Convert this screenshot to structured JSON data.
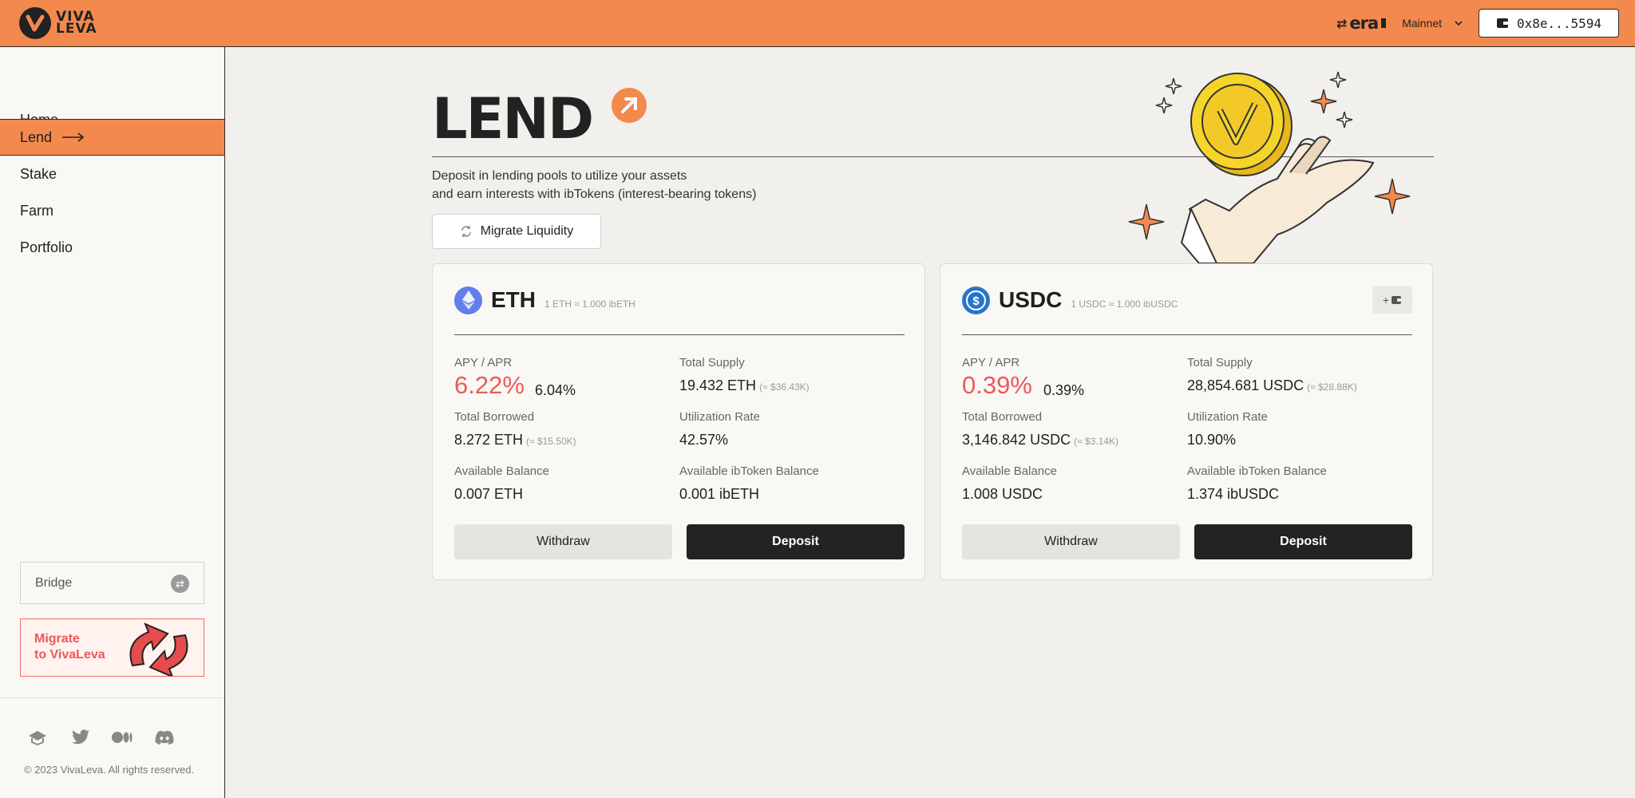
{
  "header": {
    "logo_text_line1": "VIVA",
    "logo_text_line2": "LEVA",
    "chain_name": "era",
    "network_label": "Mainnet",
    "wallet_address": "0x8e...5594"
  },
  "sidebar": {
    "items": [
      {
        "label": "Home"
      },
      {
        "label": "Lend"
      },
      {
        "label": "Stake"
      },
      {
        "label": "Farm"
      },
      {
        "label": "Portfolio"
      }
    ],
    "bridge_label": "Bridge",
    "migrate_line1": "Migrate",
    "migrate_line2": "to VivaLeva",
    "copyright": "© 2023 VivaLeva. All rights reserved."
  },
  "hero": {
    "title": "LEND",
    "desc_line1": "Deposit in lending pools to utilize your assets",
    "desc_line2": "and earn interests with ibTokens (interest-bearing tokens)",
    "migrate_liquidity": "Migrate Liquidity"
  },
  "pools": [
    {
      "token": "ETH",
      "rate": "1 ETH ≈ 1.000 ibETH",
      "apy_label": "APY / APR",
      "apy": "6.22%",
      "apr": "6.04%",
      "total_supply_label": "Total Supply",
      "total_supply": "19.432 ETH",
      "total_supply_usd": "(≈ $36.43K)",
      "total_borrowed_label": "Total Borrowed",
      "total_borrowed": "8.272 ETH",
      "total_borrowed_usd": "(≈ $15.50K)",
      "utilization_label": "Utilization Rate",
      "utilization": "42.57%",
      "available_label": "Available Balance",
      "available": "0.007 ETH",
      "ib_balance_label": "Available ibToken Balance",
      "ib_balance": "0.001 ibETH",
      "withdraw": "Withdraw",
      "deposit": "Deposit",
      "icon": "eth-icon",
      "icon_color": "#627eea"
    },
    {
      "token": "USDC",
      "rate": "1 USDC ≈ 1.000 ibUSDC",
      "apy_label": "APY / APR",
      "apy": "0.39%",
      "apr": "0.39%",
      "total_supply_label": "Total Supply",
      "total_supply": "28,854.681 USDC",
      "total_supply_usd": "(≈ $28.88K)",
      "total_borrowed_label": "Total Borrowed",
      "total_borrowed": "3,146.842 USDC",
      "total_borrowed_usd": "(≈ $3.14K)",
      "utilization_label": "Utilization Rate",
      "utilization": "10.90%",
      "available_label": "Available Balance",
      "available": "1.008 USDC",
      "ib_balance_label": "Available ibToken Balance",
      "ib_balance": "1.374 ibUSDC",
      "withdraw": "Withdraw",
      "deposit": "Deposit",
      "icon": "usdc-icon",
      "icon_color": "#2775ca",
      "add_wallet_label": "+"
    }
  ],
  "colors": {
    "accent": "#f4894e",
    "apy": "#ec5a5a",
    "dark": "#232323"
  }
}
